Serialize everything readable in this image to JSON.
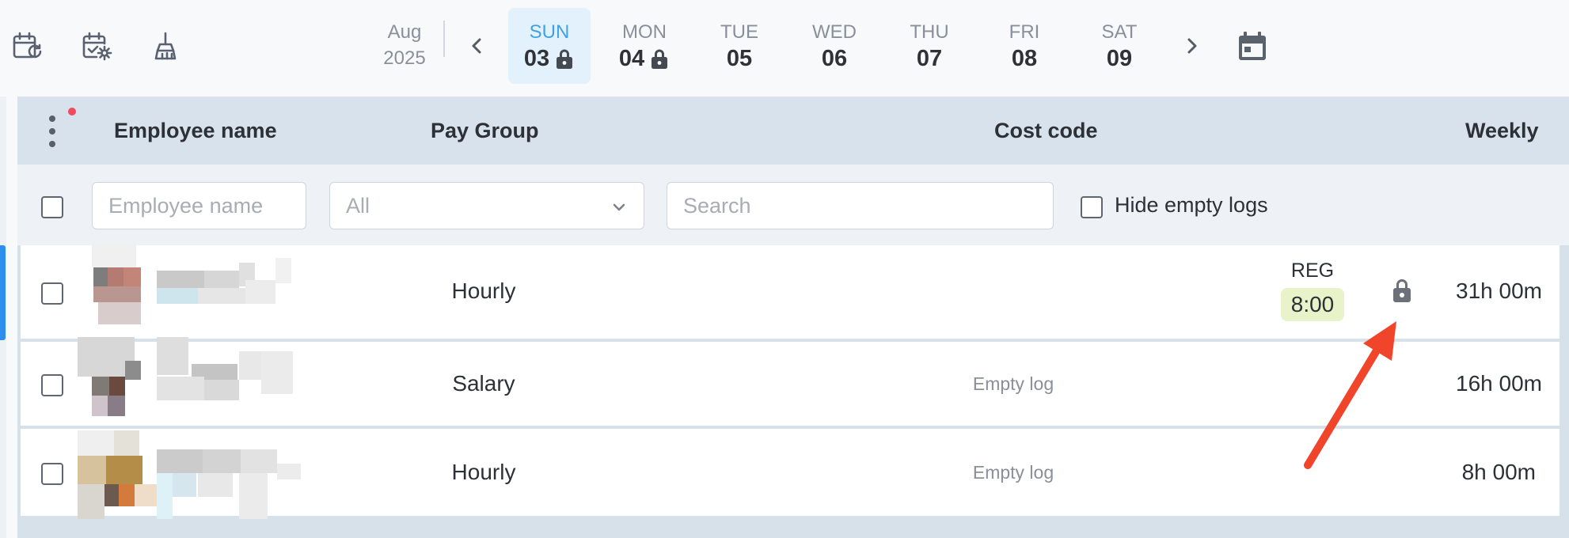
{
  "toolbar": {
    "icons": [
      "calendar-refresh-icon",
      "calendar-settings-icon",
      "broom-icon"
    ]
  },
  "week_nav": {
    "month": "Aug",
    "year": "2025",
    "prev_icon": "chevron-left-icon",
    "next_icon": "chevron-right-icon",
    "calendar_icon": "calendar-icon",
    "days": [
      {
        "name": "SUN",
        "num": "03",
        "locked": true,
        "active": true
      },
      {
        "name": "MON",
        "num": "04",
        "locked": true,
        "active": false
      },
      {
        "name": "TUE",
        "num": "05",
        "locked": false,
        "active": false
      },
      {
        "name": "WED",
        "num": "06",
        "locked": false,
        "active": false
      },
      {
        "name": "THU",
        "num": "07",
        "locked": false,
        "active": false
      },
      {
        "name": "FRI",
        "num": "08",
        "locked": false,
        "active": false
      },
      {
        "name": "SAT",
        "num": "09",
        "locked": false,
        "active": false
      }
    ]
  },
  "table": {
    "headers": {
      "employee_name": "Employee name",
      "pay_group": "Pay Group",
      "cost_code": "Cost code",
      "weekly": "Weekly"
    },
    "filters": {
      "employee_placeholder": "Employee name",
      "pay_group_value": "All",
      "search_placeholder": "Search",
      "hide_empty_logs": "Hide empty logs"
    },
    "rows": [
      {
        "pay_group": "Hourly",
        "entry_code": "REG",
        "entry_time": "8:00",
        "entry_locked": true,
        "weekly": "31h 00m"
      },
      {
        "pay_group": "Salary",
        "cost_code": "Empty log",
        "weekly": "16h 00m"
      },
      {
        "pay_group": "Hourly",
        "cost_code": "Empty log",
        "weekly": "8h 00m"
      }
    ]
  },
  "colors": {
    "accent": "#3fa2e6",
    "active_day_bg": "#e3f1fc",
    "header_bg": "#d8e2ec",
    "reg_pill_bg": "#e9f3c9",
    "annotation_arrow": "#f0452b",
    "notification_dot": "#f04a5e"
  }
}
